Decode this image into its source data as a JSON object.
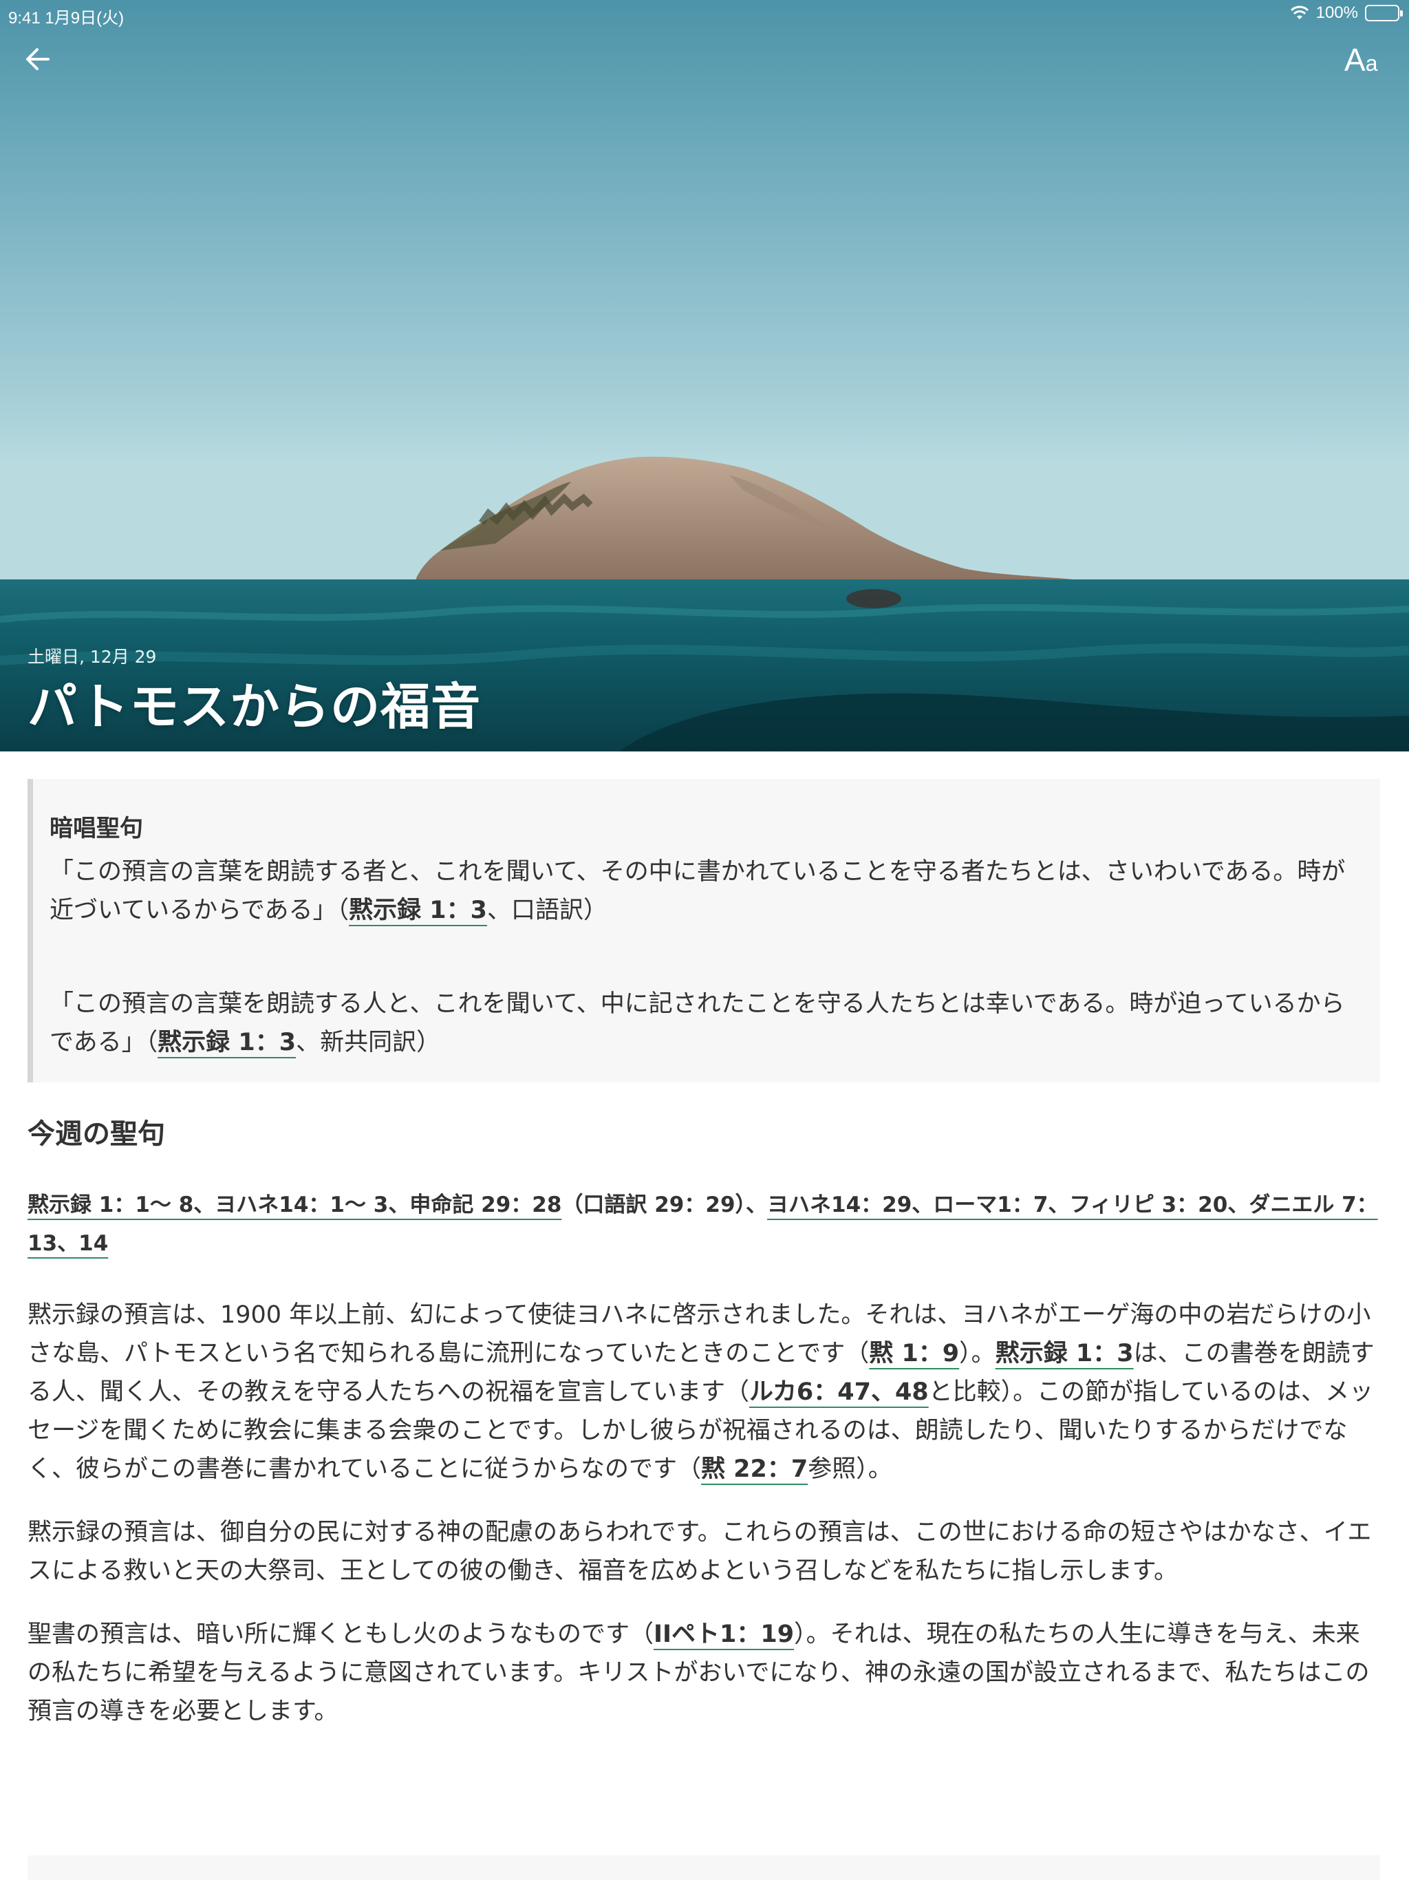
{
  "status_bar": {
    "time": "9:41",
    "date": "1月9日(火)",
    "battery": "100%"
  },
  "hero": {
    "date": "土曜日, 12月 29",
    "title": "パトモスからの福音",
    "font_button": {
      "big": "A",
      "small": "a"
    }
  },
  "memory": {
    "heading": "暗唱聖句",
    "verses": [
      {
        "text": "「この預言の言葉を朗読する者と、これを聞いて、その中に書かれていることを守る者たちとは、さいわいである。時が近づいているからである」（",
        "ref": "黙示録 1：3",
        "suffix": "、口語訳）"
      },
      {
        "text": "「この預言の言葉を朗読する人と、これを聞いて、中に記されたことを守る人たちとは幸いである。時が迫っているからである」（",
        "ref": "黙示録 1：3",
        "suffix": "、新共同訳）"
      }
    ]
  },
  "week": {
    "heading": "今週の聖句",
    "ref1": "黙示録 1：1〜 8、ヨハネ14：1〜 3、申命記 29：28",
    "mid": "（口語訳 29：29）、",
    "ref2": "ヨハネ14：29、ローマ1：7、フィリピ 3：20、ダニエル 7：13、14"
  },
  "paragraphs": {
    "p1": {
      "a": "黙示録の預言は、1900 年以上前、幻によって使徒ヨハネに啓示されました。それは、ヨハネがエーゲ海の中の岩だらけの小さな島、パトモスという名で知られる島に流刑になっていたときのことです（",
      "ref1": "黙 1：9",
      "b": "）。",
      "ref2": "黙示録 1：3",
      "c": "は、この書巻を朗読する人、聞く人、その教えを守る人たちへの祝福を宣言しています（",
      "ref3": "ルカ6：47、48",
      "d": "と比較）。この節が指しているのは、メッセージを聞くために教会に集まる会衆のことです。しかし彼らが祝福されるのは、朗読したり、聞いたりするからだけでなく、彼らがこの書巻に書かれていることに従うからなのです（",
      "ref4": "黙 22：7",
      "e": "参照）。"
    },
    "p2": "黙示録の預言は、御自分の民に対する神の配慮のあらわれです。これらの預言は、この世における命の短さやはかなさ、イエスによる救いと天の大祭司、王としての彼の働き、福音を広めよという召しなどを私たちに指し示します。",
    "p3": {
      "a": "聖書の預言は、暗い所に輝くともし火のようなものです（",
      "ref": "IIペト1：19",
      "b": "）。それは、現在の私たちの人生に導きを与え、未来の私たちに希望を与えるように意図されています。キリストがおいでになり、神の永遠の国が設立されるまで、私たちはこの預言の導きを必要とします。"
    }
  },
  "colors": {
    "accent_underline": "#2e8c5f",
    "sky": "#6aa8ba",
    "sea": "#0e5a66"
  }
}
